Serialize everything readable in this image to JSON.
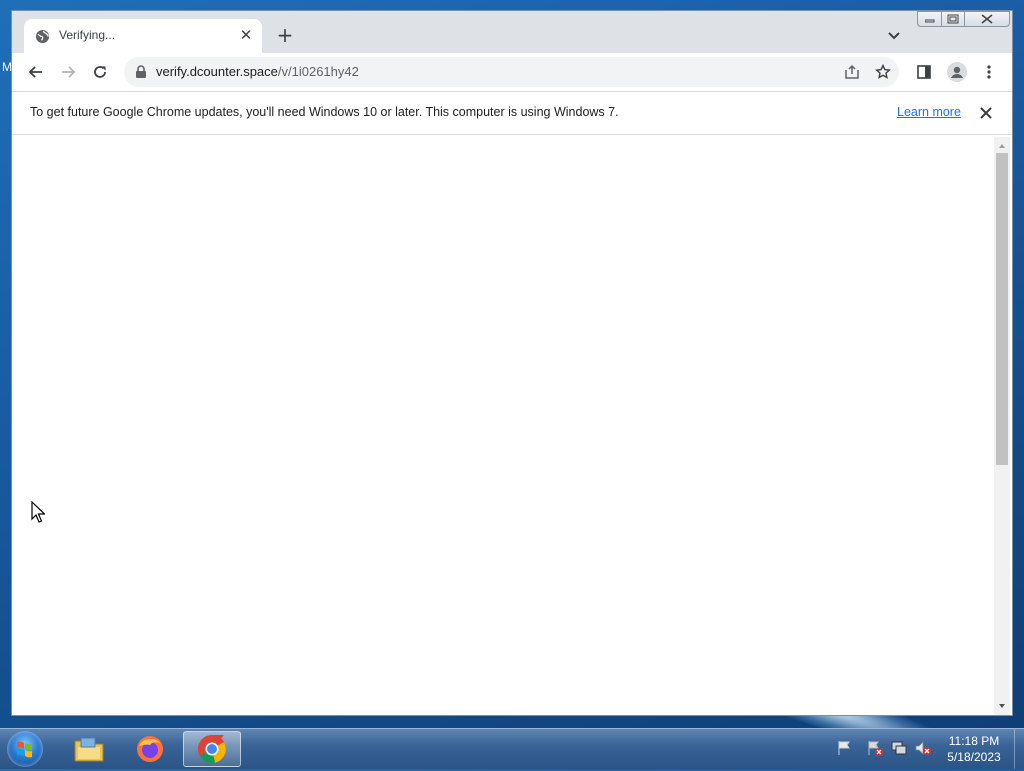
{
  "desktop": {
    "edge_text": "M"
  },
  "browser": {
    "tab": {
      "title": "Verifying...",
      "close_glyph": "✕",
      "favicon": "globe-icon"
    },
    "new_tab_glyph": "+",
    "address": {
      "host": "verify.dcounter.space",
      "path": "/v/1i0261hy42"
    },
    "infobar": {
      "message": "To get future Google Chrome updates, you'll need Windows 10 or later. This computer is using Windows 7.",
      "link": "Learn more"
    }
  },
  "taskbar": {
    "apps": [
      "windows-explorer",
      "firefox",
      "chrome"
    ],
    "active_app": "chrome",
    "clock": {
      "time": "11:18 PM",
      "date": "5/18/2023"
    }
  },
  "colors": {
    "link": "#1a73e8",
    "tab_strip": "#dee1e6",
    "omnibox": "#f1f3f4"
  }
}
